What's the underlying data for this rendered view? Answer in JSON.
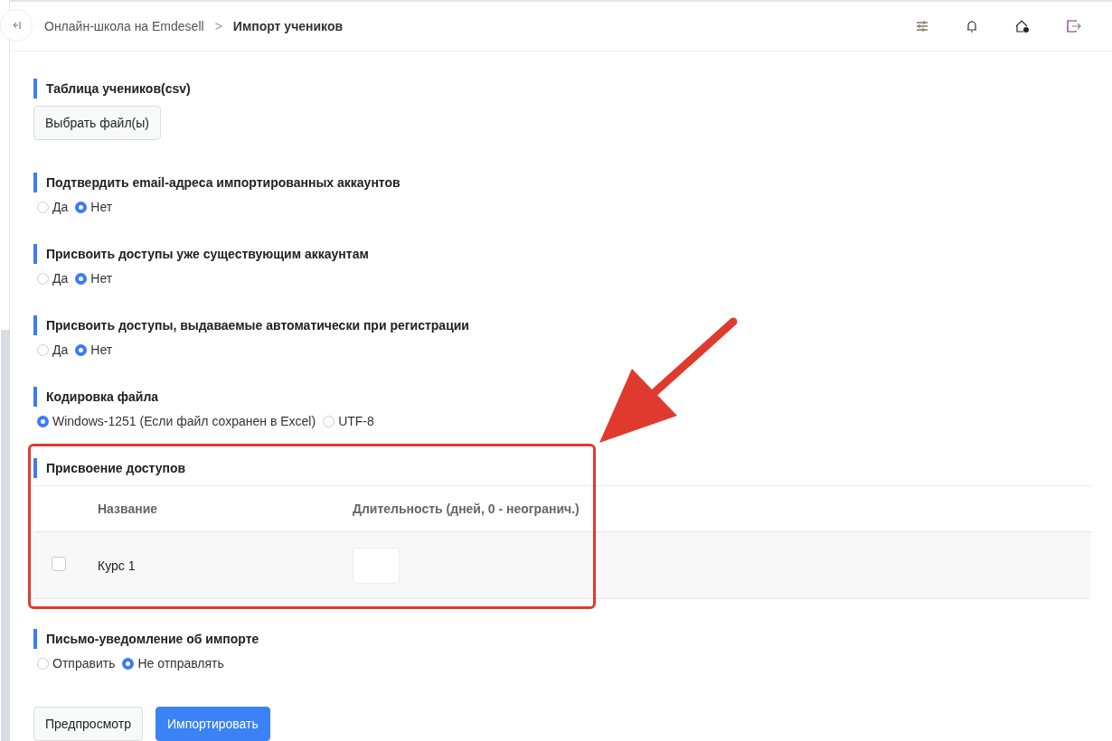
{
  "breadcrumb": [
    {
      "label": "Онлайн-школа на Emdesell",
      "current": false
    },
    {
      "label": "Импорт учеников",
      "current": true
    }
  ],
  "breadcrumb_separator": ">",
  "file_section": {
    "title": "Таблица учеников(csv)",
    "button": "Выбрать файл(ы)"
  },
  "radio_sections": [
    {
      "title": "Подтвердить email-адреса импортированных аккаунтов",
      "options": [
        {
          "label": "Да",
          "selected": false
        },
        {
          "label": "Нет",
          "selected": true
        }
      ]
    },
    {
      "title": "Присвоить доступы уже существующим аккаунтам",
      "options": [
        {
          "label": "Да",
          "selected": false
        },
        {
          "label": "Нет",
          "selected": true
        }
      ]
    },
    {
      "title": "Присвоить доступы, выдаваемые автоматически при регистрации",
      "options": [
        {
          "label": "Да",
          "selected": false
        },
        {
          "label": "Нет",
          "selected": true
        }
      ]
    },
    {
      "title": "Кодировка файла",
      "options": [
        {
          "label": "Windows-1251 (Если файл сохранен в Excel)",
          "selected": true
        },
        {
          "label": "UTF-8",
          "selected": false
        }
      ]
    }
  ],
  "access_section": {
    "title": "Присвоение доступов",
    "columns": [
      "Название",
      "Длительность (дней, 0 - неогранич.)"
    ],
    "rows": [
      {
        "checked": false,
        "name": "Курс 1"
      }
    ]
  },
  "notify_section": {
    "title": "Письмо-уведомление об импорте",
    "options": [
      {
        "label": "Отправить",
        "selected": false
      },
      {
        "label": "Не отправлять",
        "selected": true
      }
    ]
  },
  "buttons": [
    {
      "label": "Предпросмотр",
      "kind": "secondary"
    },
    {
      "label": "Импортировать",
      "kind": "primary"
    }
  ]
}
